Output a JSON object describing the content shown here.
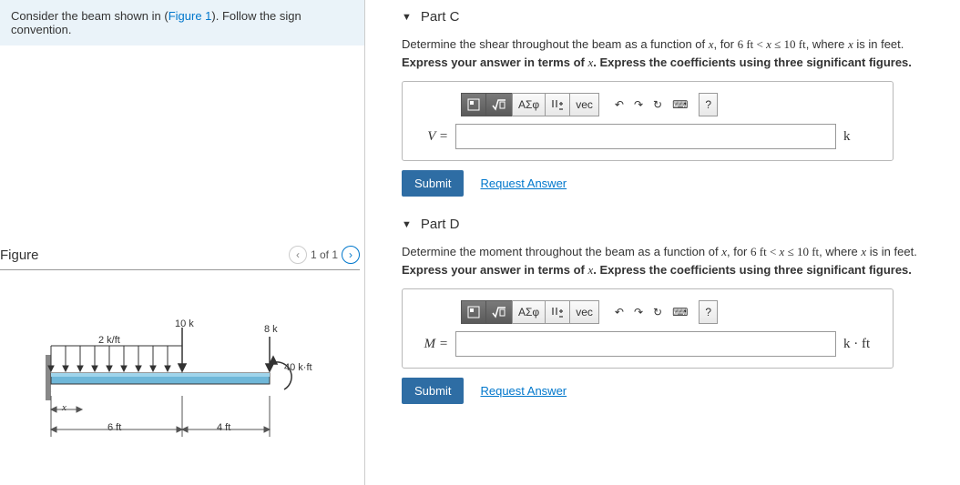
{
  "intro": {
    "pre": "Consider the beam shown in (",
    "link": "Figure 1",
    "post": "). Follow the sign convention."
  },
  "figure": {
    "label": "Figure",
    "pager": "1 of 1",
    "dist_load": "2 k/ft",
    "point_load": "10 k",
    "end_load": "8 k",
    "moment": "40 k·ft",
    "dim_x": "x",
    "dim1": "6 ft",
    "dim2": "4 ft"
  },
  "toolbar": {
    "templates_alt": "templates",
    "sqrt_alt": "root",
    "greek": "ΑΣφ",
    "arrows_alt": "subscript",
    "vec": "vec",
    "undo_alt": "undo",
    "redo_alt": "redo",
    "reset_alt": "reset",
    "keyboard_alt": "keyboard",
    "help": "?"
  },
  "partC": {
    "title": "Part C",
    "desc_pre": "Determine the shear throughout the beam as a function of ",
    "var": "x",
    "desc_mid": ", for ",
    "range": "6 ft < x ≤ 10 ft",
    "desc_post": ", where ",
    "desc_end": " is in feet.",
    "instr_pre": "Express your answer in terms of ",
    "instr_post": ". Express the coefficients using three significant figures.",
    "lhs": "V =",
    "unit": "k",
    "submit": "Submit",
    "request": "Request Answer",
    "value": ""
  },
  "partD": {
    "title": "Part D",
    "desc_pre": "Determine the moment throughout the beam as a function of ",
    "var": "x",
    "desc_mid": ", for ",
    "range": "6 ft < x ≤ 10 ft",
    "desc_post": ", where ",
    "desc_end": " is in feet.",
    "instr_pre": "Express your answer in terms of ",
    "instr_post": ". Express the coefficients using three significant figures.",
    "lhs": "M =",
    "unit": "k · ft",
    "submit": "Submit",
    "request": "Request Answer",
    "value": ""
  }
}
